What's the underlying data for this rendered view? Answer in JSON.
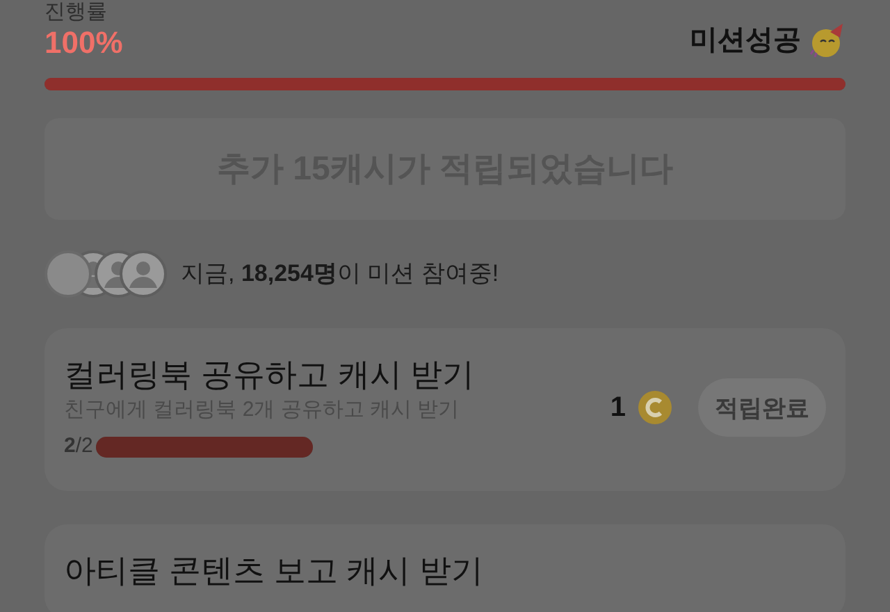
{
  "progress": {
    "label": "진행률",
    "percent": "100%",
    "status": "미션성공",
    "level": 1
  },
  "banner": {
    "text": "추가 15캐시가 적립되었습니다"
  },
  "participants": {
    "text": "지금, **18,254명**이 미션 참여중!"
  },
  "missions": [
    {
      "title": "컬러링북 공유하고 캐시 받기",
      "subtitle": "친구에게 컬러링북 2개 공유하고 캐시 받기",
      "count": "**2**/2",
      "level": 1,
      "reward": "1",
      "button": "적립완료",
      "disabled": true
    },
    {
      "title": "아티클 콘텐츠 보고 캐시 받기"
    }
  ]
}
